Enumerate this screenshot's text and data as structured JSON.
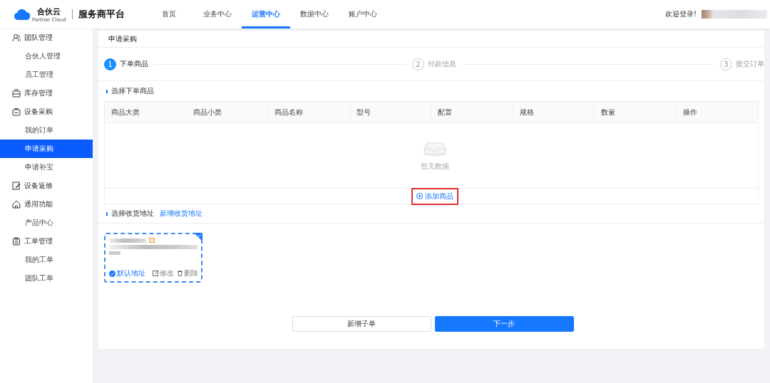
{
  "header": {
    "logo_name": "合伙云",
    "logo_sub": "Partner Cloud",
    "platform": "服务商平台",
    "nav": [
      {
        "label": "首页",
        "selected": false
      },
      {
        "label": "业务中心",
        "selected": false
      },
      {
        "label": "运营中心",
        "selected": true
      },
      {
        "label": "数据中心",
        "selected": false
      },
      {
        "label": "账户中心",
        "selected": false
      }
    ],
    "welcome": "欢迎登录!"
  },
  "sidebar": {
    "items": [
      {
        "label": "团队管理",
        "selected": false,
        "children": [
          {
            "label": "合伙人管理",
            "selected": false
          },
          {
            "label": "员工管理",
            "selected": false
          }
        ]
      },
      {
        "label": "库存管理",
        "selected": false
      },
      {
        "label": "设备采购",
        "selected": false,
        "children": [
          {
            "label": "我的订单",
            "selected": false
          },
          {
            "label": "申请采购",
            "selected": true
          },
          {
            "label": "申请补宝",
            "selected": false
          }
        ]
      },
      {
        "label": "设备返修",
        "selected": false
      },
      {
        "label": "通用功能",
        "selected": false,
        "children": [
          {
            "label": "产品中心",
            "selected": false
          }
        ]
      },
      {
        "label": "工单管理",
        "selected": false,
        "children": [
          {
            "label": "我的工单",
            "selected": false
          },
          {
            "label": "团队工单",
            "selected": false
          }
        ]
      }
    ]
  },
  "page_title": "申请采购",
  "steps": [
    {
      "number": "1",
      "label": "下单商品",
      "active": true
    },
    {
      "number": "2",
      "label": "付款信息",
      "active": false
    },
    {
      "number": "3",
      "label": "提交订单",
      "active": false
    }
  ],
  "goods_section": {
    "title": "选择下单商品",
    "table": {
      "columns": [
        "商品大类",
        "商品小类",
        "商品名称",
        "型号",
        "配置",
        "规格",
        "数量",
        "操作"
      ],
      "empty_text": "暂无数据"
    },
    "add_button": {
      "label": "添加商品",
      "highlighted": true
    }
  },
  "address_section": {
    "title": "选择收货地址",
    "link": "新增收货地址",
    "cards": [
      {
        "selected": true,
        "default": true,
        "default_label": "默认地址",
        "edit_label": "修改",
        "delete_label": "删除"
      }
    ]
  },
  "buttons": [
    {
      "label": "新增子单",
      "kind": "secondary"
    },
    {
      "label": "下一步",
      "kind": "primary"
    }
  ]
}
